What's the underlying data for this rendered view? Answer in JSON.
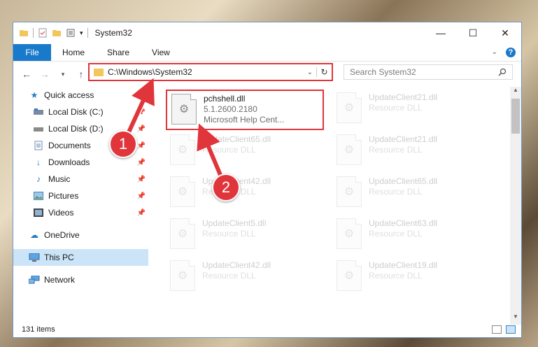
{
  "window": {
    "title": "System32",
    "controls": {
      "minimize": "—",
      "maximize": "☐",
      "close": "✕"
    }
  },
  "ribbon": {
    "tabs": [
      "File",
      "Home",
      "Share",
      "View"
    ],
    "help": "?"
  },
  "nav": {
    "address": "C:\\Windows\\System32",
    "search_placeholder": "Search System32"
  },
  "sidebar": {
    "quick_access": "Quick access",
    "items": [
      {
        "label": "Local Disk (C:)",
        "icon": "drive-icon"
      },
      {
        "label": "Local Disk (D:)",
        "icon": "drive-icon"
      },
      {
        "label": "Documents",
        "icon": "documents-icon"
      },
      {
        "label": "Downloads",
        "icon": "downloads-icon"
      },
      {
        "label": "Music",
        "icon": "music-icon"
      },
      {
        "label": "Pictures",
        "icon": "pictures-icon"
      },
      {
        "label": "Videos",
        "icon": "videos-icon"
      }
    ],
    "onedrive": "OneDrive",
    "thispc": "This PC",
    "network": "Network"
  },
  "files": [
    {
      "name": "pchshell.dll",
      "line2": "5.1.2600.2180",
      "line3": "Microsoft Help Cent...",
      "highlight": true
    },
    {
      "name": "UpdateClient21.dll",
      "line2": "Resource DLL"
    },
    {
      "name": "UpdateClient65.dll",
      "line2": "Resource DLL"
    },
    {
      "name": "UpdateClient21.dll",
      "line2": "Resource DLL"
    },
    {
      "name": "UpdateClient42.dll",
      "line2": "Resource DLL"
    },
    {
      "name": "UpdateClient65.dll",
      "line2": "Resource DLL"
    },
    {
      "name": "UpdateClient5.dll",
      "line2": "Resource DLL"
    },
    {
      "name": "UpdateClient63.dll",
      "line2": "Resource DLL"
    },
    {
      "name": "UpdateClient42.dll",
      "line2": "Resource DLL"
    },
    {
      "name": "UpdateClient19.dll",
      "line2": "Resource DLL"
    }
  ],
  "status": {
    "count": "131 items"
  },
  "callouts": {
    "one": "1",
    "two": "2"
  },
  "colors": {
    "accent": "#1979ca",
    "highlight_red": "#e0353b",
    "selected": "#cce4f7"
  }
}
